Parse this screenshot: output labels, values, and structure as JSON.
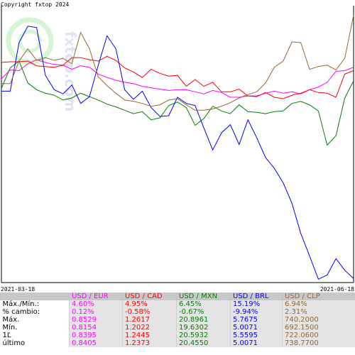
{
  "copyright": "Copyright fxtop 2024",
  "watermark": "fxtop.com",
  "chart_data": {
    "type": "line",
    "x_start": "2021-03-18",
    "x_end": "2021-06-18",
    "normalized": true,
    "series": [
      {
        "name": "USD / EUR",
        "color": "#ff00ff",
        "values": [
          0.28,
          0.41,
          0.4,
          0.5,
          0.56,
          0.52,
          0.49,
          0.48,
          0.42,
          0.47,
          0.45,
          0.35,
          0.3,
          0.26,
          0.23,
          0.21,
          0.17,
          0.15,
          0.13,
          0.11,
          0.12,
          0.12,
          0.09,
          0.06,
          0.11,
          0.08,
          0.01,
          0.01,
          0.03,
          0.03,
          0.07,
          0.1,
          0.07,
          0.09,
          0.06,
          0.12,
          0.16,
          0.23,
          0.39,
          0.4,
          0.45
        ]
      },
      {
        "name": "USD / CAD",
        "color": "#ff0000",
        "values": [
          0.52,
          0.53,
          0.53,
          0.54,
          0.47,
          0.46,
          0.45,
          0.48,
          0.59,
          0.59,
          0.56,
          0.54,
          0.61,
          0.55,
          0.44,
          0.38,
          0.3,
          0.42,
          0.36,
          0.32,
          0.33,
          0.17,
          0.27,
          0.17,
          0.23,
          0.09,
          0.09,
          0.13,
          0.03,
          0.02,
          0.08,
          0.01,
          -0.01,
          0.04,
          0.07,
          0.12,
          0.08,
          0.07,
          0.01,
          0.35,
          0.4
        ]
      },
      {
        "name": "USD / MXN",
        "color": "#008000",
        "values": [
          0.14,
          0.44,
          0.54,
          0.22,
          0.12,
          0.07,
          0.04,
          -0.03,
          0.0,
          0.07,
          0.02,
          -0.03,
          -0.09,
          -0.13,
          -0.18,
          -0.23,
          -0.2,
          -0.32,
          -0.29,
          -0.11,
          -0.06,
          -0.14,
          -0.4,
          -0.3,
          -0.12,
          -0.19,
          -0.23,
          -0.1,
          -0.2,
          -0.21,
          -0.23,
          -0.2,
          -0.19,
          -0.08,
          -0.05,
          -0.1,
          -0.19,
          -0.69,
          -0.55,
          0.0,
          0.25
        ]
      },
      {
        "name": "USD / BRL",
        "color": "#0000ff",
        "values": [
          0.1,
          0.1,
          0.81,
          1.05,
          1.03,
          0.33,
          0.12,
          0.06,
          0.19,
          -0.08,
          0.02,
          0.48,
          0.91,
          0.72,
          0.12,
          -0.02,
          0.1,
          -0.14,
          -0.27,
          -0.26,
          0.01,
          -0.08,
          -0.11,
          -0.44,
          -0.76,
          -0.51,
          -0.39,
          -0.68,
          -0.32,
          -0.58,
          -0.87,
          -1.03,
          -1.24,
          -1.54,
          -1.98,
          -2.31,
          -2.65,
          -2.59,
          -2.35,
          -2.52,
          -2.64
        ]
      },
      {
        "name": "USD / CLP",
        "color": "#996633",
        "values": [
          0.21,
          0.21,
          0.54,
          0.72,
          0.55,
          0.59,
          0.55,
          0.58,
          0.5,
          0.96,
          0.72,
          0.31,
          0.18,
          0.07,
          -0.03,
          -0.05,
          -0.08,
          -0.12,
          -0.1,
          -0.03,
          -0.01,
          -0.1,
          -0.18,
          -0.18,
          -0.16,
          -0.12,
          -0.07,
          0.0,
          0.05,
          0.09,
          0.22,
          0.45,
          0.54,
          0.82,
          0.81,
          0.42,
          0.46,
          0.48,
          0.41,
          0.58,
          1.21
        ]
      }
    ],
    "ylim": [
      -2.7,
      1.35
    ]
  },
  "axis": {
    "start_label": "2021-03-18",
    "end_label": "2021-06-18"
  },
  "table": {
    "headers": [
      "USD / EUR",
      "USD / CAD",
      "USD / MXN",
      "USD / BRL",
      "USD / CLP"
    ],
    "header_colors": [
      "#ff00ff",
      "#ff0000",
      "#008000",
      "#0000ff",
      "#996633"
    ],
    "rows": [
      {
        "label": "Máx./Mín.:",
        "values": [
          "4.60%",
          "4.95%",
          "6.45%",
          "15.19%",
          "6.94%"
        ]
      },
      {
        "label": "% cambio:",
        "values": [
          "0.12%",
          "-0.58%",
          "-0.67%",
          "-9.94%",
          "2.31%"
        ]
      },
      {
        "label": "Máx.",
        "values": [
          "0.8529",
          "1.2617",
          "20.8961",
          "5.7675",
          "740.2000"
        ]
      },
      {
        "label": "Mín.",
        "values": [
          "0.8154",
          "1.2022",
          "19.6302",
          "5.0071",
          "692.1500"
        ]
      },
      {
        "label": "1Ľ",
        "values": [
          "0.8395",
          "1.2445",
          "20.5932",
          "5.5595",
          "722.0600"
        ]
      },
      {
        "label": "último",
        "values": [
          "0.8405",
          "1.2373",
          "20.4550",
          "5.0071",
          "738.7700"
        ]
      }
    ]
  }
}
